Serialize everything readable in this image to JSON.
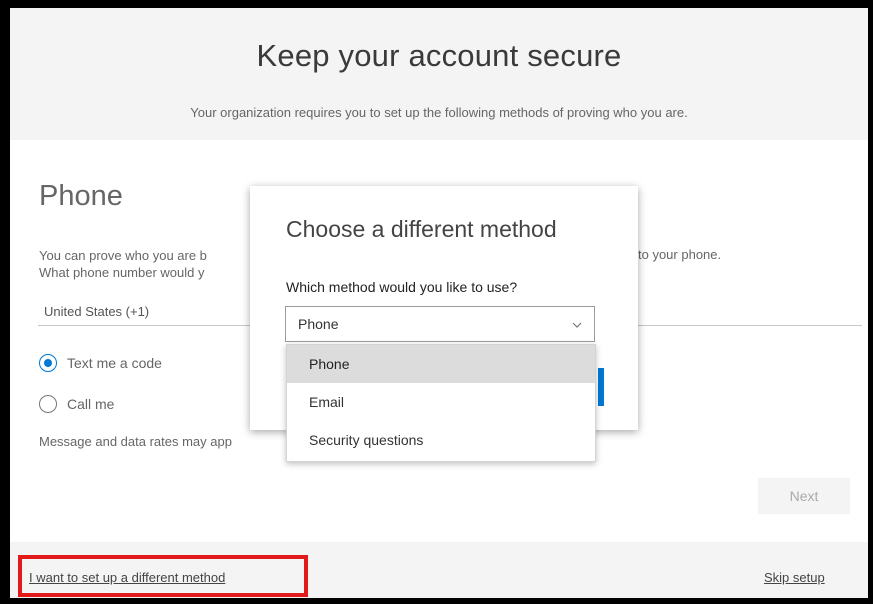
{
  "header": {
    "title": "Keep your account secure",
    "subtitle": "Your organization requires you to set up the following methods of proving who you are."
  },
  "phone_section": {
    "title": "Phone",
    "description_line1": "You can prove who you are b",
    "description_line2": "What phone number would y",
    "description_tail": "to your phone.",
    "country_value": "United States (+1)",
    "radio_text": "Text me a code",
    "radio_call": "Call me",
    "selected_radio": "text",
    "rates_note": "Message and data rates may app",
    "next_label": "Next"
  },
  "footer": {
    "different_method_link": "I want to set up a different method",
    "skip_link": "Skip setup"
  },
  "dialog": {
    "title": "Choose a different method",
    "question": "Which method would you like to use?",
    "selected_value": "Phone",
    "options": [
      "Phone",
      "Email",
      "Security questions"
    ]
  },
  "colors": {
    "accent": "#0078d4",
    "highlight": "#e31a1a",
    "header_bg": "#f4f4f4"
  },
  "icons": {
    "dropdown": "chevron-down-icon"
  }
}
